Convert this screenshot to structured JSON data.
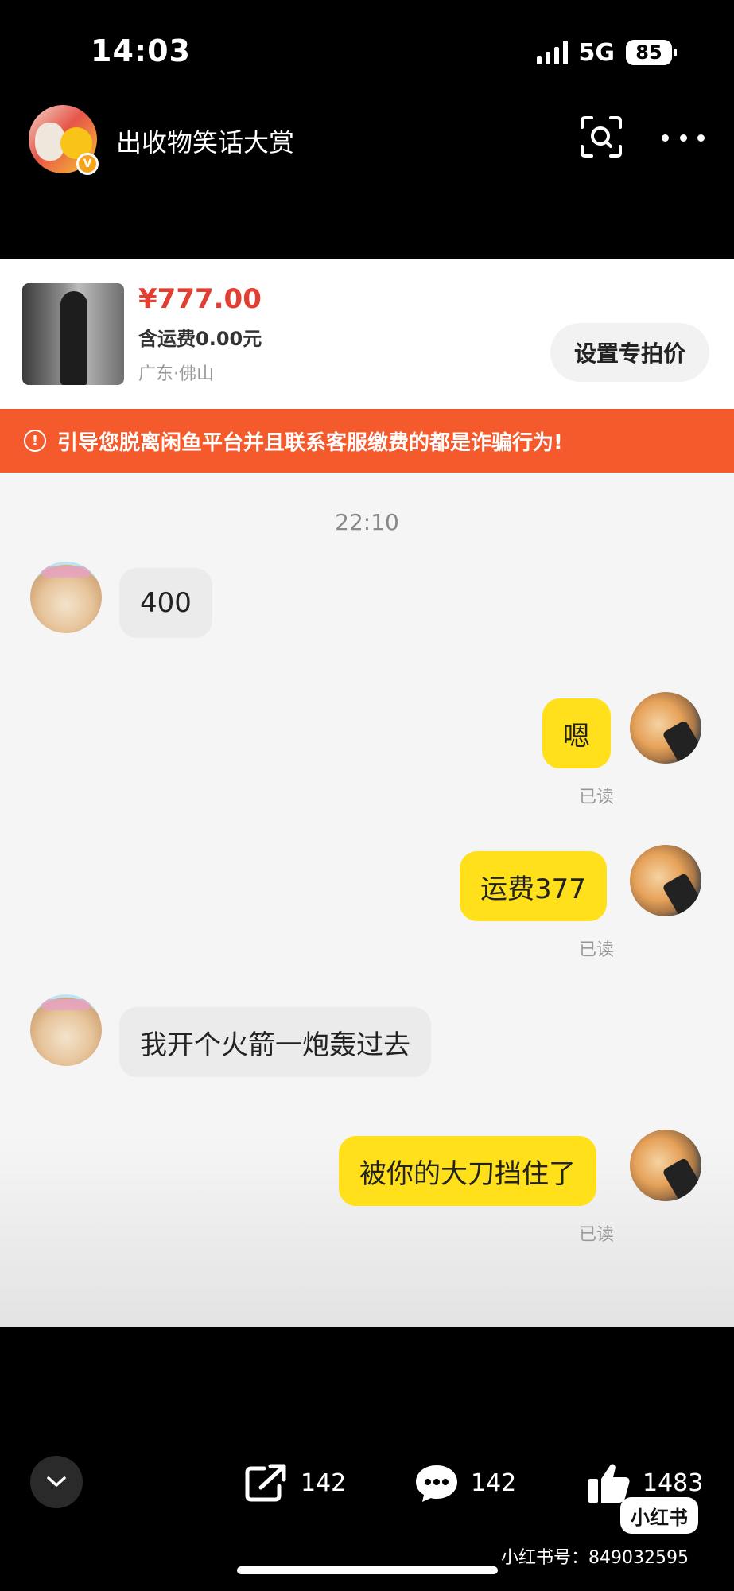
{
  "status_bar": {
    "time": "14:03",
    "network": "5G",
    "battery": "85"
  },
  "post": {
    "title": "出收物笑话大赏",
    "badge": "V"
  },
  "product": {
    "price": "¥777.00",
    "shipping": "含运费0.00元",
    "location": "广东·佛山",
    "set_price_label": "设置专拍价"
  },
  "warning": {
    "icon": "!",
    "text": "引导您脱离闲鱼平台并且联系客服缴费的都是诈骗行为!"
  },
  "chat": {
    "timestamp": "22:10",
    "messages": [
      {
        "side": "left",
        "text": "400"
      },
      {
        "side": "right",
        "text": "嗯",
        "status": "已读"
      },
      {
        "side": "right",
        "text": "运费377",
        "status": "已读"
      },
      {
        "side": "left",
        "text": "我开个火箭一炮轰过去"
      },
      {
        "side": "right",
        "text": "被你的大刀挡住了",
        "status": "已读"
      }
    ]
  },
  "bottom_bar": {
    "share_count": "142",
    "comment_count": "142",
    "like_count": "1483",
    "logo": "小红书",
    "watermark": "小红书号：849032595"
  },
  "icons": {
    "scan": "scan-icon",
    "more": "more-icon",
    "collapse": "chevron-down-icon",
    "share": "share-icon",
    "comment": "comment-icon",
    "like": "thumbs-up-icon"
  }
}
